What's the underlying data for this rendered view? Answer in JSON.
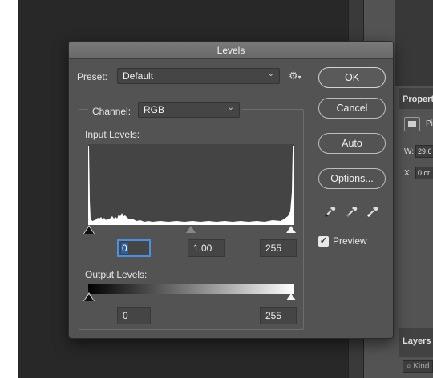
{
  "dialog": {
    "title": "Levels",
    "preset_label": "Preset:",
    "preset_value": "Default",
    "channel_label": "Channel:",
    "channel_value": "RGB",
    "input_levels_label": "Input Levels:",
    "input_black": "0",
    "input_gamma": "1.00",
    "input_white": "255",
    "output_levels_label": "Output Levels:",
    "output_black": "0",
    "output_white": "255",
    "buttons": {
      "ok": "OK",
      "cancel": "Cancel",
      "auto": "Auto",
      "options": "Options..."
    },
    "preview_label": "Preview",
    "preview_checked": true,
    "icons": [
      "chevron-down-icon",
      "gear-icon",
      "black-eyedropper-icon",
      "gray-eyedropper-icon",
      "white-eyedropper-icon",
      "checkmark-icon"
    ]
  },
  "properties_panel": {
    "title": "Propert",
    "icon_label": "Pi",
    "w_label": "W:",
    "w_value": "29.6",
    "x_label": "X:",
    "x_value": "0 cr"
  },
  "layers_panel": {
    "title": "Layers",
    "kind_placeholder": "⌕ Kind"
  },
  "colors": {
    "dialog_bg": "#535353",
    "workspace_bg": "#282828",
    "focus_blue": "#4a90e2"
  }
}
